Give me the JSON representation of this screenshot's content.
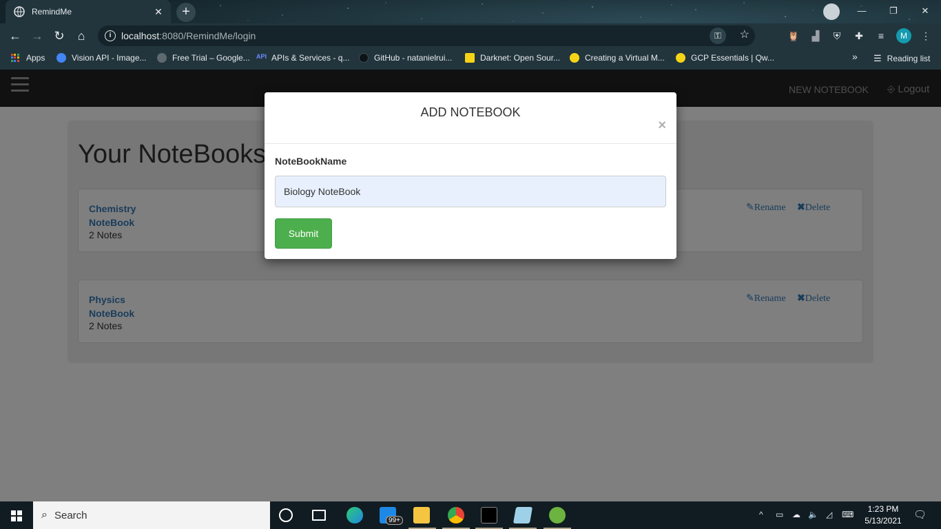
{
  "browser": {
    "tab_title": "RemindMe",
    "tab_close": "✕",
    "new_tab": "+",
    "url_host": "localhost",
    "url_path": ":8080/RemindMe/login",
    "profile_initial": "M",
    "window_controls": [
      "—",
      "❐",
      "✕"
    ],
    "bookmarks": [
      {
        "label": "Apps",
        "icon": "apps-grid-icon"
      },
      {
        "label": "Vision API - Image...",
        "icon": "google-cloud-icon",
        "color": "#4285f4"
      },
      {
        "label": "Free Trial – Google...",
        "icon": "gear-icon",
        "color": "#9aa0a6"
      },
      {
        "label": "APIs & Services - q...",
        "icon": "api-icon",
        "color": "#6a8cff"
      },
      {
        "label": "GitHub - natanielrui...",
        "icon": "github-icon",
        "color": "#000000"
      },
      {
        "label": "Darknet: Open Sour...",
        "icon": "darknet-icon",
        "color": "#f5d417"
      },
      {
        "label": "Creating a Virtual M...",
        "icon": "qwiklabs-icon",
        "color": "#f5d417"
      },
      {
        "label": "GCP Essentials | Qw...",
        "icon": "qwiklabs-icon",
        "color": "#f5d417"
      }
    ],
    "bookmarks_overflow": "»",
    "reading_list": "Reading list"
  },
  "app": {
    "nav_new_notebook": "NEW NOTEBOOK",
    "nav_logout": "Logout",
    "page_title": "Your NoteBooks",
    "notebooks": [
      {
        "name": "Chemistry NoteBook",
        "count": "2 Notes",
        "rename": "Rename",
        "delete": "Delete"
      },
      {
        "name": "Physics NoteBook",
        "count": "2 Notes",
        "rename": "Rename",
        "delete": "Delete"
      }
    ]
  },
  "modal": {
    "title": "ADD NOTEBOOK",
    "close": "×",
    "field_label": "NoteBookName",
    "field_value": "Biology NoteBook",
    "submit": "Submit"
  },
  "taskbar": {
    "search_placeholder": "Search",
    "mail_badge": "99+",
    "time": "1:23 PM",
    "date": "5/13/2021"
  }
}
